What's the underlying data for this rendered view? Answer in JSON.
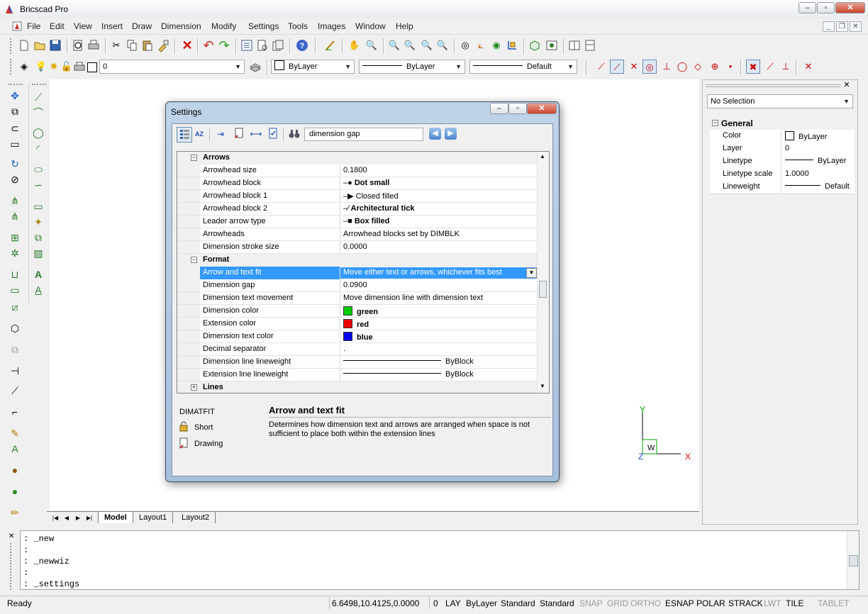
{
  "window": {
    "title": "Bricscad Pro"
  },
  "menu": [
    "File",
    "Edit",
    "View",
    "Insert",
    "Draw",
    "Dimension",
    "Modify",
    "Settings",
    "Tools",
    "Images",
    "Window",
    "Help"
  ],
  "layer_toolbar": {
    "layer_value": "0",
    "color_value": "ByLayer",
    "linetype_value": "ByLayer",
    "lineweight_value": "Default"
  },
  "tabs": [
    "Model",
    "Layout1",
    "Layout2"
  ],
  "properties_panel": {
    "selection": "No Selection",
    "section": "General",
    "rows": [
      {
        "key": "Color",
        "value": "ByLayer"
      },
      {
        "key": "Layer",
        "value": "0"
      },
      {
        "key": "Linetype",
        "value": "ByLayer"
      },
      {
        "key": "Linetype scale",
        "value": "1.0000"
      },
      {
        "key": "Lineweight",
        "value": "Default"
      }
    ]
  },
  "ucs": {
    "y": "Y",
    "x": "X",
    "z": "Z",
    "w": "W"
  },
  "command_line": [
    ": _new",
    ":",
    ": _newwiz",
    ":",
    ": _settings"
  ],
  "status": {
    "ready": "Ready",
    "coords": "6.6498,10.4125,0.0000",
    "items": [
      "0",
      "LAY",
      "ByLayer",
      "Standard",
      "Standard",
      "SNAP",
      "GRID",
      "ORTHO",
      "ESNAP",
      "POLAR",
      "STRACK",
      "LWT",
      "TILE",
      "TABLET"
    ]
  },
  "settings": {
    "title": "Settings",
    "search": "dimension gap",
    "sections": {
      "arrows": "Arrows",
      "format": "Format",
      "lines": "Lines"
    },
    "arrows_rows": [
      {
        "key": "Arrowhead size",
        "value": "0.1800"
      },
      {
        "key": "Arrowhead block",
        "value": "Dot small"
      },
      {
        "key": "Arrowhead block 1",
        "value": "Closed filled"
      },
      {
        "key": "Arrowhead block 2",
        "value": "Architectural tick"
      },
      {
        "key": "Leader arrow type",
        "value": "Box filled"
      },
      {
        "key": "Arrowheads",
        "value": "Arrowhead blocks set by DIMBLK"
      },
      {
        "key": "Dimension stroke size",
        "value": "0.0000"
      }
    ],
    "format_rows": [
      {
        "key": "Arrow and text fit",
        "value": "Move either text or arrows, whichever fits best"
      },
      {
        "key": "Dimension gap",
        "value": "0.0900"
      },
      {
        "key": "Dimension text movement",
        "value": "Move dimension line with dimension text"
      },
      {
        "key": "Dimension color",
        "value": "green",
        "color": "#00cc00"
      },
      {
        "key": "Extension color",
        "value": "red",
        "color": "#ee0000"
      },
      {
        "key": "Dimension text color",
        "value": "blue",
        "color": "#0000ee"
      },
      {
        "key": "Decimal separator",
        "value": "."
      },
      {
        "key": "Dimension line lineweight",
        "value": "ByBlock"
      },
      {
        "key": "Extension line lineweight",
        "value": "ByBlock"
      }
    ],
    "varname": "DIMATFIT",
    "short_label": "Short",
    "drawing_label": "Drawing",
    "desc_title": "Arrow and text fit",
    "desc_text": "Determines how dimension text and arrows are arranged when space is not sufficient to place both within the extension lines"
  },
  "colors": {
    "selected_row": "#3399ff",
    "accent": "#0078d7"
  }
}
